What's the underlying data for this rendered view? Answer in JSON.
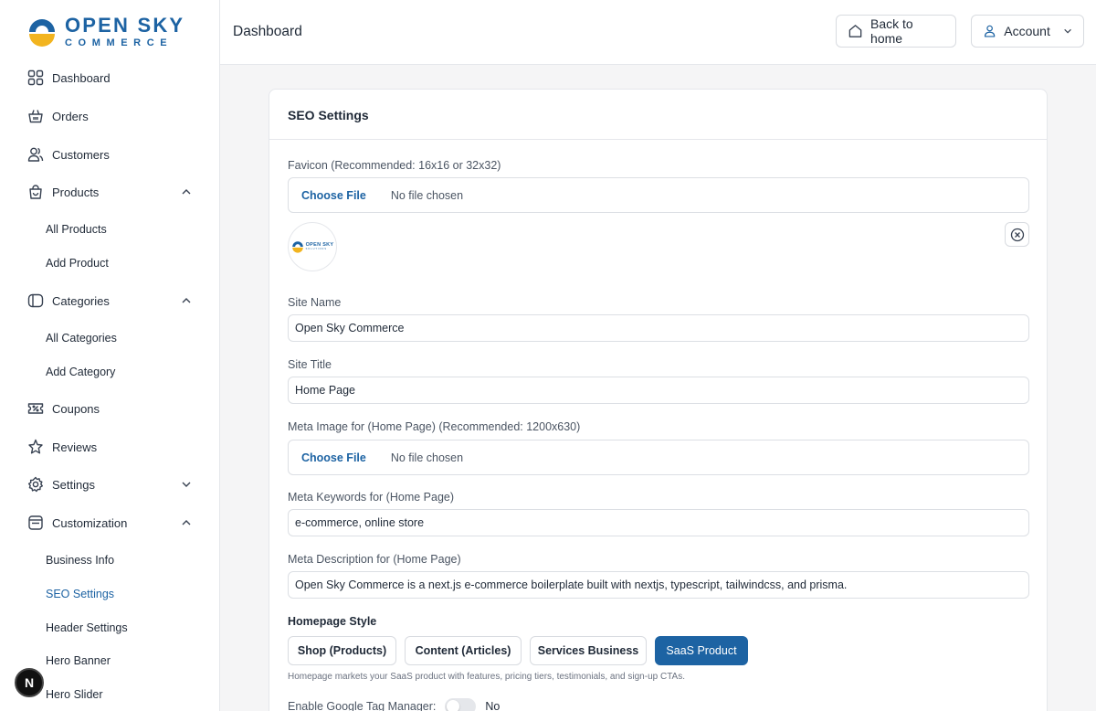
{
  "brand": {
    "title": "OPEN SKY",
    "subtitle": "COMMERCE"
  },
  "sidebar": {
    "items": [
      {
        "label": "Dashboard"
      },
      {
        "label": "Orders"
      },
      {
        "label": "Customers"
      },
      {
        "label": "Products"
      },
      {
        "label": "Categories"
      },
      {
        "label": "Coupons"
      },
      {
        "label": "Reviews"
      },
      {
        "label": "Settings"
      },
      {
        "label": "Customization"
      }
    ],
    "products_sub": [
      "All Products",
      "Add Product"
    ],
    "categories_sub": [
      "All Categories",
      "Add Category"
    ],
    "customization_sub": [
      "Business Info",
      "SEO Settings",
      "Header Settings",
      "Hero Banner",
      "Hero Slider"
    ]
  },
  "badge": {
    "label": "N"
  },
  "header": {
    "title": "Dashboard",
    "back_label": "Back to home",
    "account_label": "Account"
  },
  "card": {
    "title": "SEO Settings",
    "favicon_label": "Favicon (Recommended: 16x16 or 32x32)",
    "choose_file": "Choose File",
    "no_file": "No file chosen",
    "preview_title": "OPEN SKY",
    "preview_sub": "SOLUTIONS",
    "site_name_label": "Site Name",
    "site_name_value": "Open Sky Commerce",
    "site_title_label": "Site Title",
    "site_title_value": "Home Page",
    "meta_image_label": "Meta Image for (Home Page) (Recommended: 1200x630)",
    "meta_keywords_label": "Meta Keywords for (Home Page)",
    "meta_keywords_value": "e-commerce, online store",
    "meta_description_label": "Meta Description for (Home Page)",
    "meta_description_value": "Open Sky Commerce is a next.js e-commerce boilerplate built with nextjs, typescript, tailwindcss, and prisma.",
    "homepage_style_label": "Homepage Style",
    "styles": [
      {
        "label": "Shop (Products)"
      },
      {
        "label": "Content (Articles)"
      },
      {
        "label": "Services Business"
      },
      {
        "label": "SaaS Product"
      }
    ],
    "selected_style": "SaaS Product",
    "style_helper": "Homepage markets your SaaS product with features, pricing tiers, testimonials, and sign-up CTAs.",
    "gtm_label": "Enable Google Tag Manager:",
    "gtm_state": "No"
  },
  "colors": {
    "accent": "#1d63a3",
    "logo_yellow": "#f2b41f",
    "logo_blue": "#1d63a3"
  }
}
